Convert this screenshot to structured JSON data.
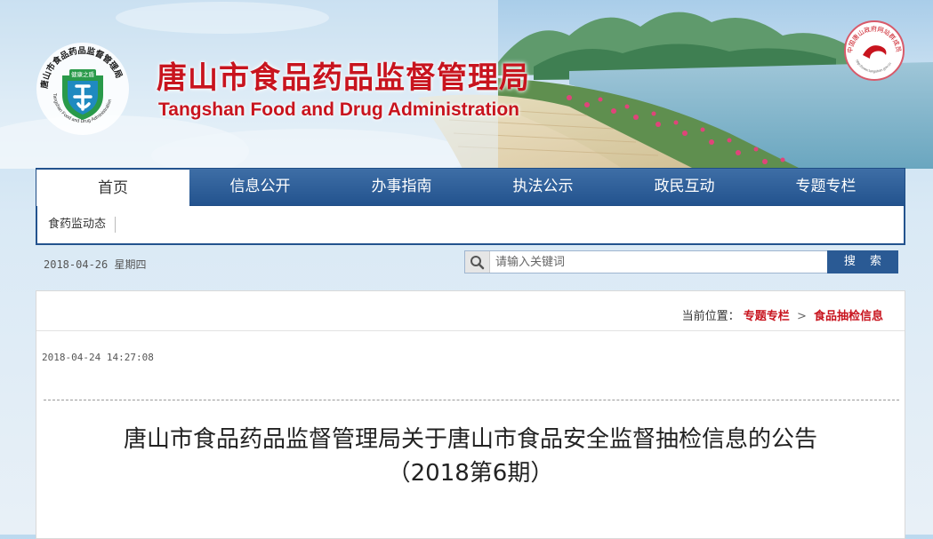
{
  "header": {
    "title_cn": "唐山市食品药品监督管理局",
    "title_en": "Tangshan Food and Drug Administration",
    "logo": {
      "ring_text": "唐山市食品药品监督管理局",
      "ring_text_en": "Tangshan Food and Drug Administration",
      "badge": "健康之盾"
    },
    "seal": {
      "ring_text": "中国唐山政府网站群成员",
      "url": "http://www.tangshan.gov.cn"
    }
  },
  "nav": {
    "items": [
      {
        "label": "首页"
      },
      {
        "label": "信息公开"
      },
      {
        "label": "办事指南"
      },
      {
        "label": "执法公示"
      },
      {
        "label": "政民互动"
      },
      {
        "label": "专题专栏"
      }
    ],
    "sub_item": "食药监动态"
  },
  "toolbar": {
    "date": "2018-04-26",
    "weekday": "星期四",
    "search_placeholder": "请输入关键词",
    "search_button": "搜 索"
  },
  "main": {
    "breadcrumb": {
      "prefix": "当前位置：",
      "level1": "专题专栏",
      "separator": ">",
      "level2": "食品抽检信息"
    },
    "publish_time": "2018-04-24 14:27:08",
    "title_line1": "唐山市食品药品监督管理局关于唐山市食品安全监督抽检信息的公告",
    "title_line2": "（2018第6期）"
  },
  "colors": {
    "brand_red": "#c8141e",
    "nav_blue": "#23538e",
    "accent_green": "#2a9a4a"
  }
}
